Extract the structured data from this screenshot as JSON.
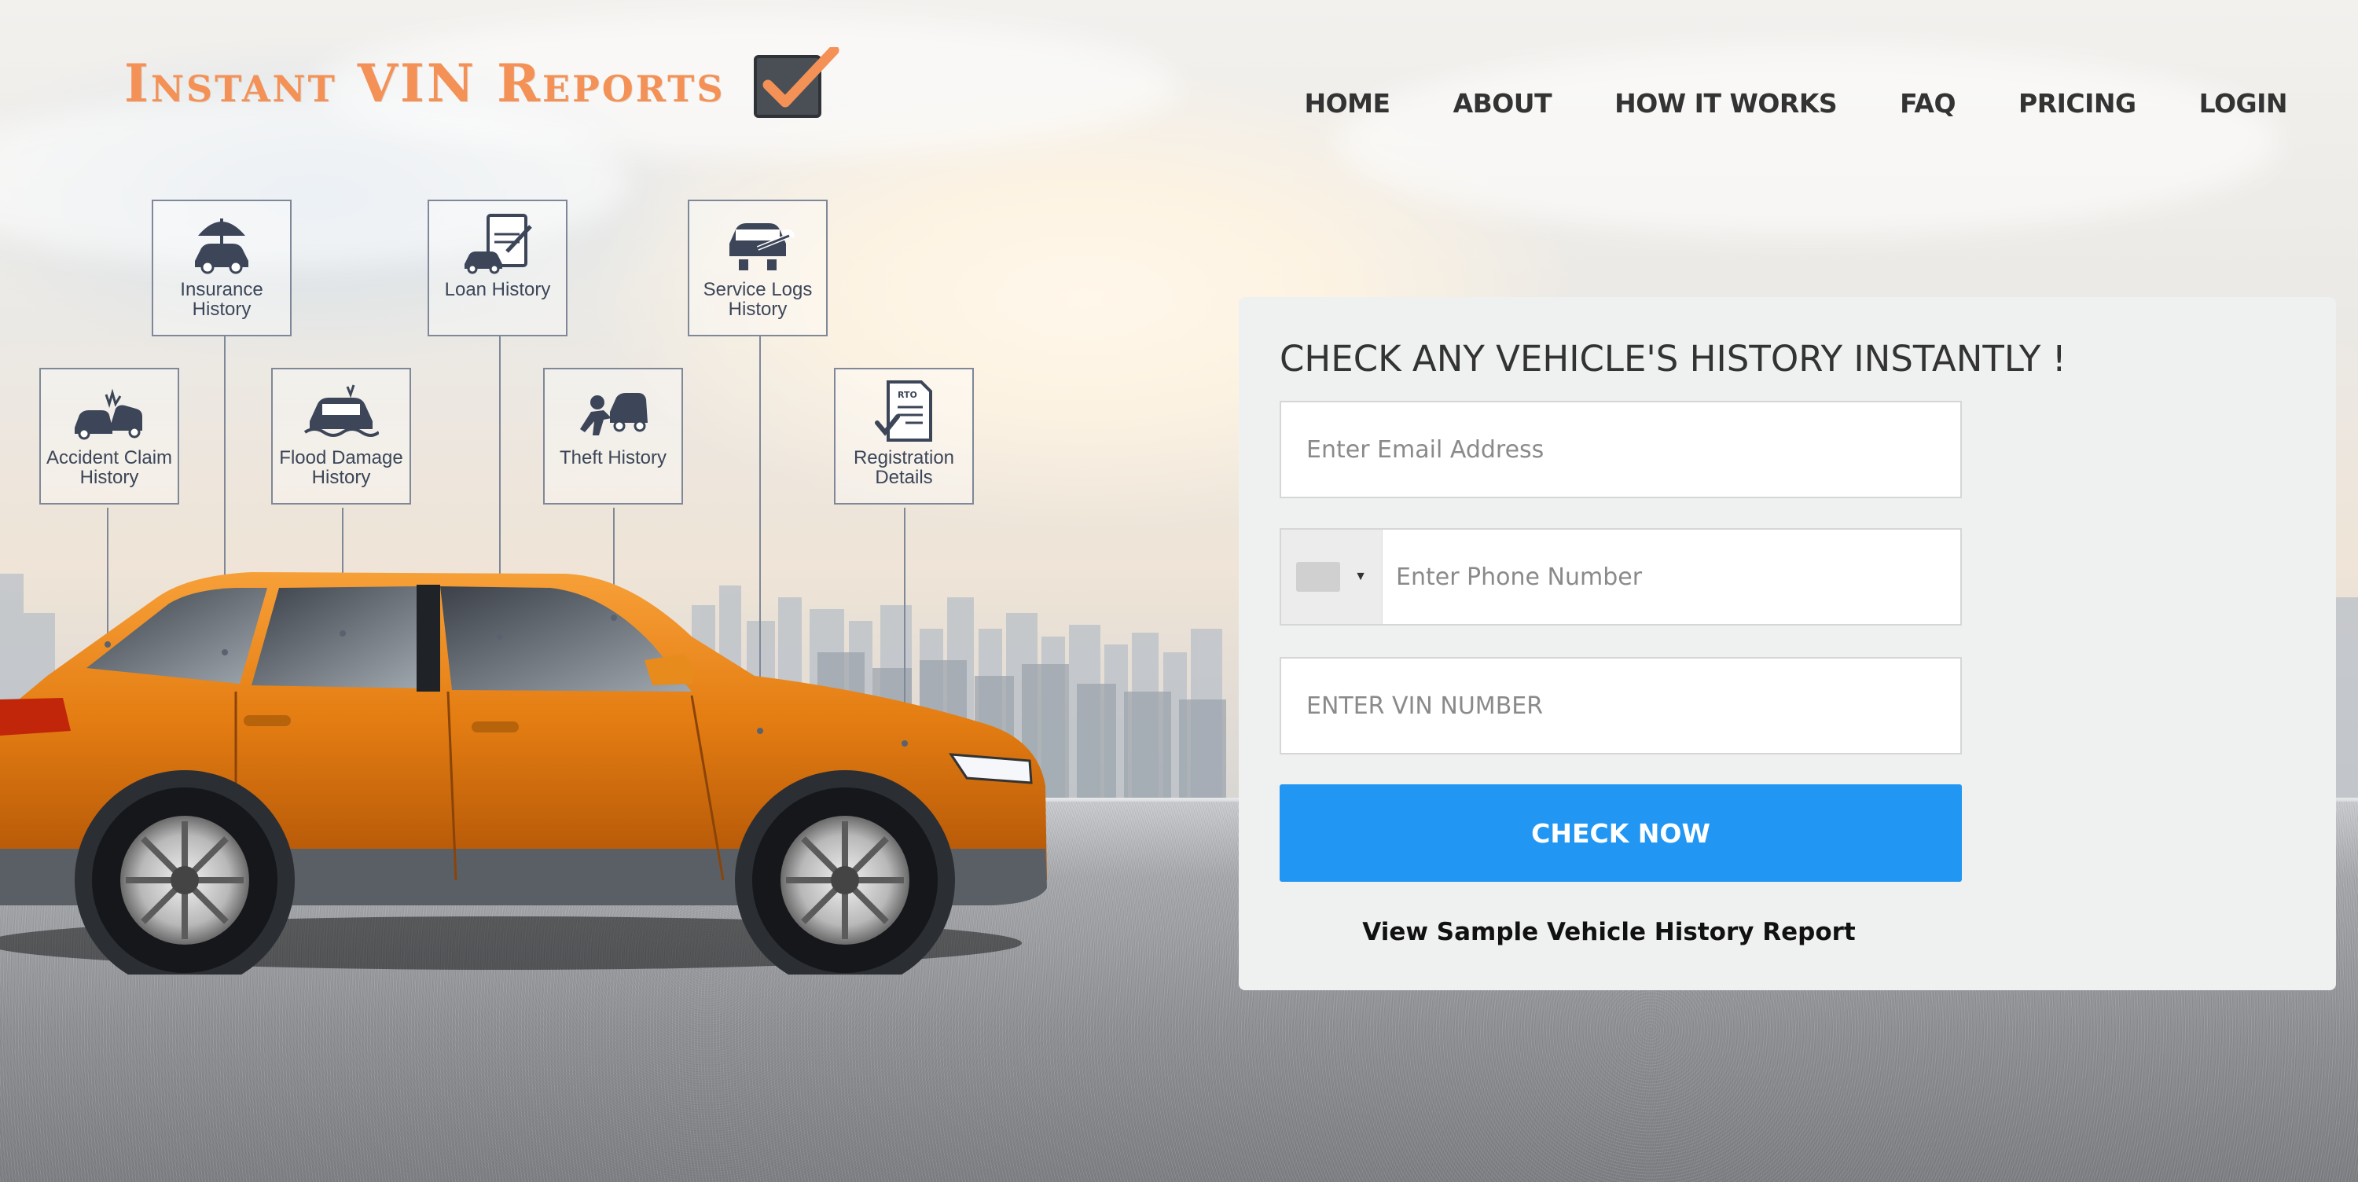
{
  "brand": {
    "name": "Instant VIN Reports",
    "check_icon": "checkbox-check-icon",
    "color": "#f39156"
  },
  "nav": {
    "items": [
      "HOME",
      "ABOUT",
      "HOW IT WORKS",
      "FAQ",
      "PRICING",
      "LOGIN"
    ]
  },
  "features": [
    {
      "icon": "umbrella-car-icon",
      "label": "Insurance History"
    },
    {
      "icon": "loan-document-car-icon",
      "label": "Loan History"
    },
    {
      "icon": "wrench-car-icon",
      "label": "Service Logs History"
    },
    {
      "icon": "car-crash-icon",
      "label": "Accident Claim History"
    },
    {
      "icon": "flooded-car-icon",
      "label": "Flood Damage History"
    },
    {
      "icon": "thief-car-icon",
      "label": "Theft History"
    },
    {
      "icon": "rto-document-icon",
      "label": "Registration Details"
    }
  ],
  "form": {
    "title": "CHECK ANY VEHICLE'S HISTORY INSTANTLY !",
    "email_placeholder": "Enter Email Address",
    "phone_placeholder": "Enter Phone Number",
    "vin_placeholder": "ENTER VIN NUMBER",
    "submit_label": "CHECK NOW",
    "sample_link": "View Sample Vehicle History Report",
    "accent_color": "#2196f3"
  }
}
